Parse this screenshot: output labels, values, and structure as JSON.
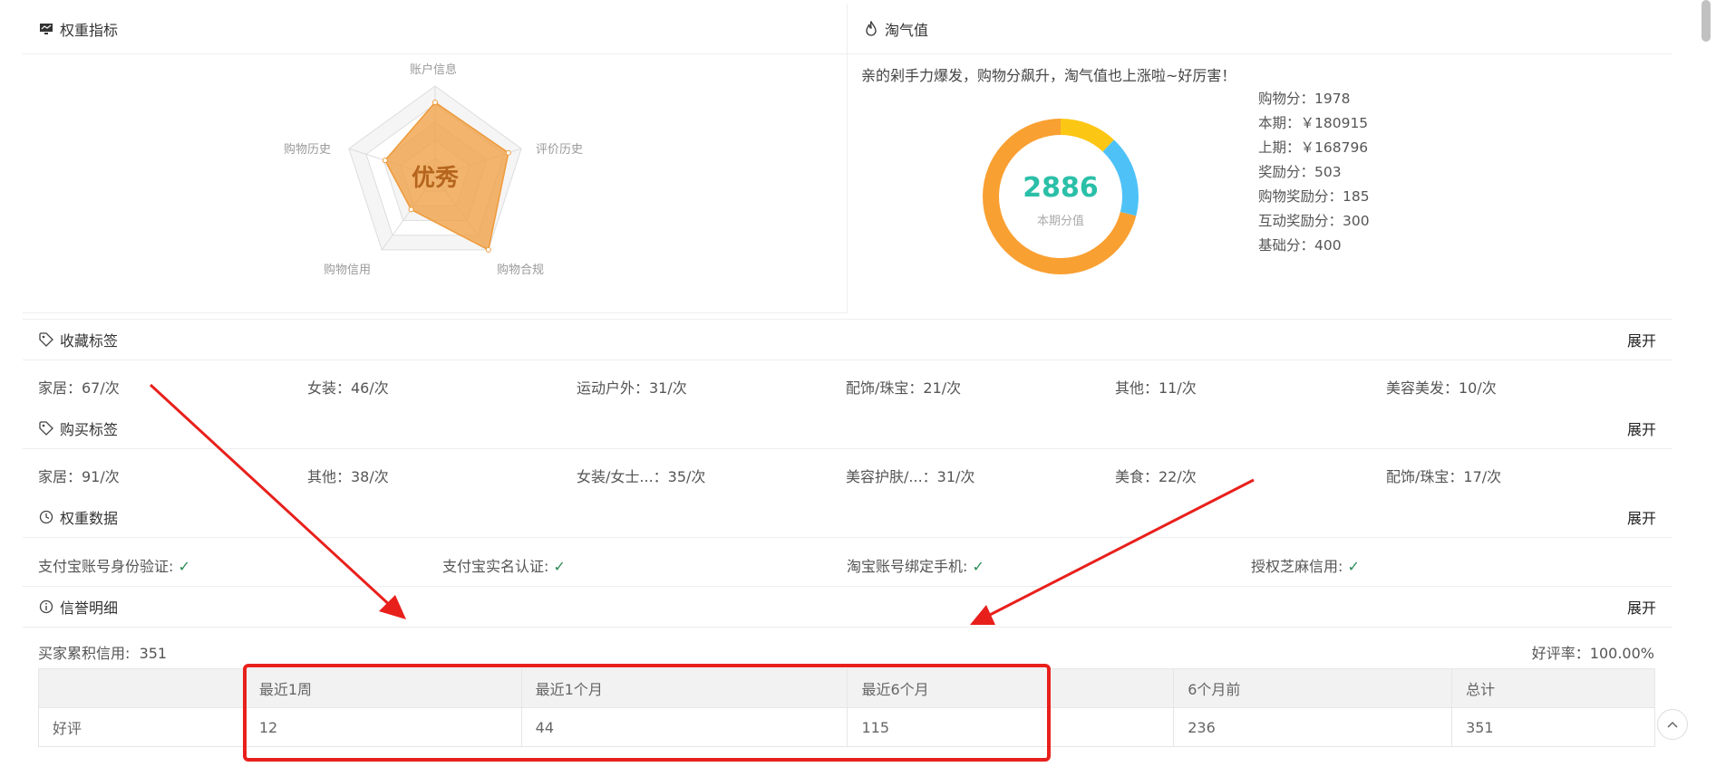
{
  "weight_panel": {
    "title": "权重指标"
  },
  "radar": {
    "center_text": "优秀",
    "labels": [
      "账户信息",
      "评价历史",
      "购物合规",
      "购物信用",
      "购物历史"
    ],
    "values": [
      0.82,
      0.85,
      1.0,
      0.45,
      0.58
    ],
    "color": "#f0a34a"
  },
  "taoqi": {
    "title": "淘气值",
    "description": "亲的剁手力爆发，购物分飙升，淘气值也上涨啦~好厉害！",
    "score": "2886",
    "score_label": "本期分值",
    "donut": [
      {
        "name": "yellow",
        "value": 0.12,
        "color": "#fcc615"
      },
      {
        "name": "blue",
        "value": 0.17,
        "color": "#4ec2f7"
      },
      {
        "name": "orange",
        "value": 0.71,
        "color": "#f9a032"
      }
    ],
    "stats": [
      "购物分：1978",
      "本期：￥180915",
      "上期：￥168796",
      "奖励分：503",
      "购物奖励分：185",
      "互动奖励分：300",
      "基础分：400"
    ]
  },
  "collect_tags": {
    "title": "收藏标签",
    "expand": "展开",
    "items": [
      "家居：67/次",
      "女装：46/次",
      "运动户外：31/次",
      "配饰/珠宝：21/次",
      "其他：11/次",
      "美容美发：10/次"
    ]
  },
  "buy_tags": {
    "title": "购买标签",
    "expand": "展开",
    "items": [
      "家居：91/次",
      "其他：38/次",
      "女装/女士...：35/次",
      "美容护肤/...：31/次",
      "美食：22/次",
      "配饰/珠宝：17/次"
    ]
  },
  "weight_data": {
    "title": "权重数据",
    "expand": "展开",
    "items": [
      "支付宝账号身份验证:",
      "支付宝实名认证:",
      "淘宝账号绑定手机:",
      "授权芝麻信用:"
    ],
    "check": "✓"
  },
  "credit": {
    "title": "信誉明细",
    "expand": "展开",
    "buyer_credit": "买家累积信用:  351",
    "good_rate": "好评率：100.00%",
    "headers": [
      "",
      "最近1周",
      "最近1个月",
      "最近6个月",
      "6个月前",
      "总计"
    ],
    "row": [
      "好评",
      "12",
      "44",
      "115",
      "236",
      "351"
    ]
  },
  "colors": {
    "accent": "#2bbfa8",
    "annotation": "#e8201c",
    "check": "#2e8b57"
  }
}
